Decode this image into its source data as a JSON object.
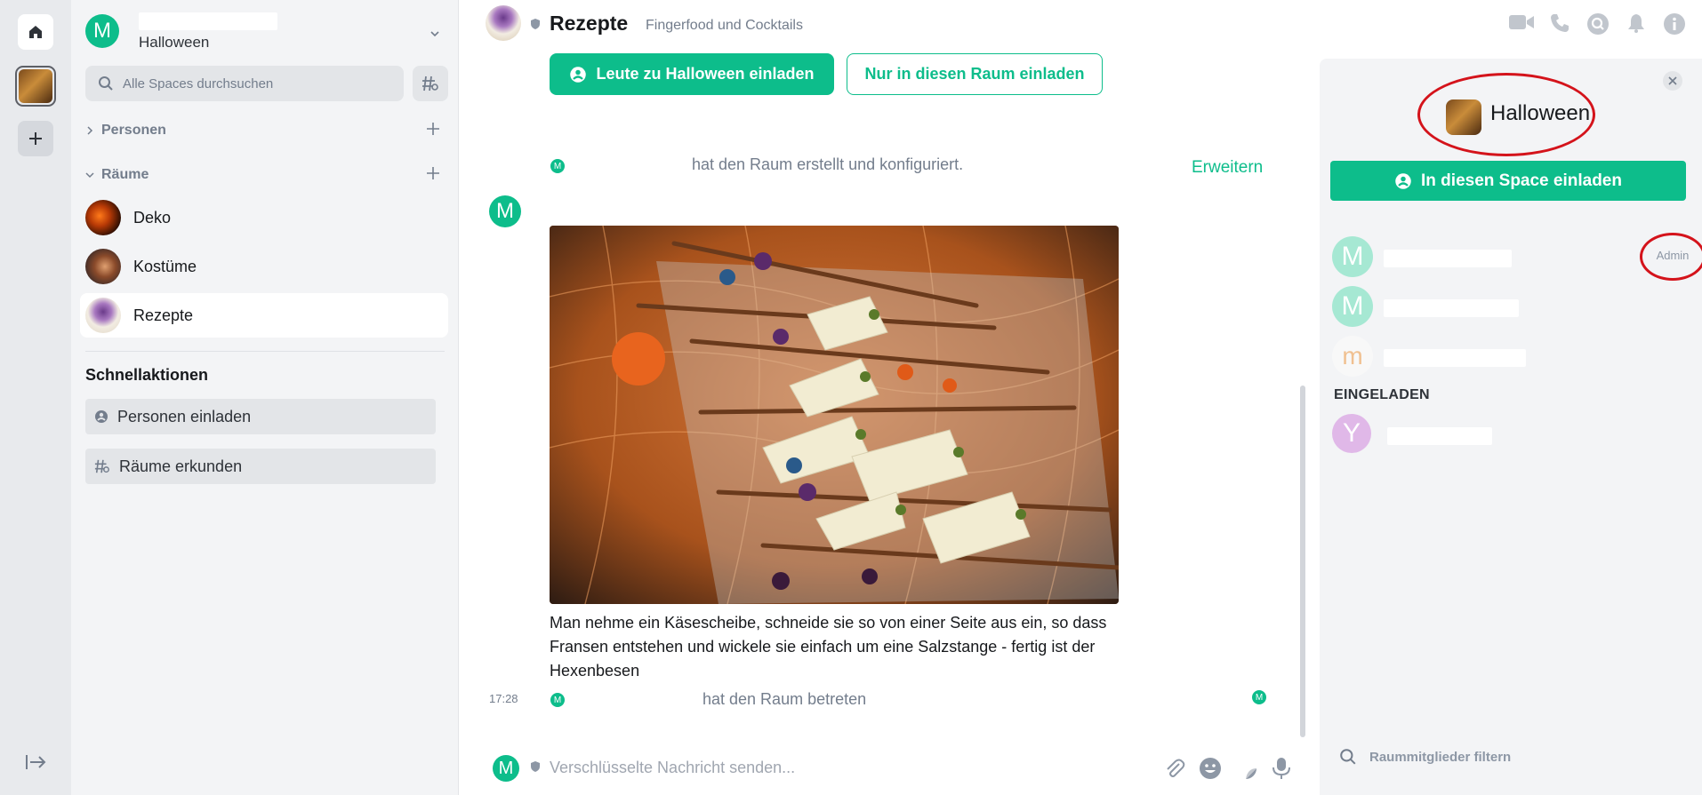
{
  "app": {
    "accent": "#0dbd8b",
    "annotation_color": "#d4131b"
  },
  "rail": {
    "home_icon": "home-icon",
    "space_label": "Halloween",
    "add_icon": "plus-icon",
    "collapse_icon": "expand-arrow-icon"
  },
  "sidebar": {
    "space_name": "Halloween",
    "space_avatar_letter": "M",
    "search_placeholder": "Alle Spaces durchsuchen",
    "sections": {
      "people": "Personen",
      "rooms": "Räume"
    },
    "rooms": [
      {
        "name": "Deko",
        "active": false
      },
      {
        "name": "Kostüme",
        "active": false
      },
      {
        "name": "Rezepte",
        "active": true
      }
    ],
    "quick_actions": {
      "title": "Schnellaktionen",
      "invite": "Personen einladen",
      "explore": "Räume erkunden"
    }
  },
  "room_header": {
    "name": "Rezepte",
    "topic": "Fingerfood und Cocktails",
    "icons": [
      "video-call-icon",
      "voice-call-icon",
      "search-icon",
      "notifications-icon",
      "room-info-icon"
    ]
  },
  "timeline": {
    "invite_space_button": "Leute zu Halloween einladen",
    "invite_room_button": "Nur in diesen Raum einladen",
    "created_event": "hat den Raum erstellt und konfiguriert.",
    "expand_link": "Erweitern",
    "sender_avatar_letter": "M",
    "image_alt": "Hexenbesen aus Käse und Salzstangen",
    "caption": "Man nehme ein Käsescheibe, schneide sie so von einer Seite aus ein, so dass Fransen entstehen und wickele sie einfach um eine Salzstange - fertig ist der Hexenbesen",
    "timestamp": "17:28",
    "joined_event": "hat den Raum betreten"
  },
  "composer": {
    "avatar_letter": "M",
    "placeholder": "Verschlüsselte Nachricht senden...",
    "icons": [
      "attachment-icon",
      "emoji-icon",
      "sticker-icon",
      "microphone-icon"
    ]
  },
  "right_panel": {
    "space_name": "Halloween",
    "invite_button": "In diesen Space einladen",
    "members": [
      {
        "letter": "M",
        "role": "Admin"
      },
      {
        "letter": "M",
        "role": ""
      },
      {
        "letter": "m",
        "role": ""
      }
    ],
    "invited_title": "EINGELADEN",
    "invited": [
      {
        "letter": "Y"
      }
    ],
    "filter_placeholder": "Raummitglieder filtern"
  }
}
